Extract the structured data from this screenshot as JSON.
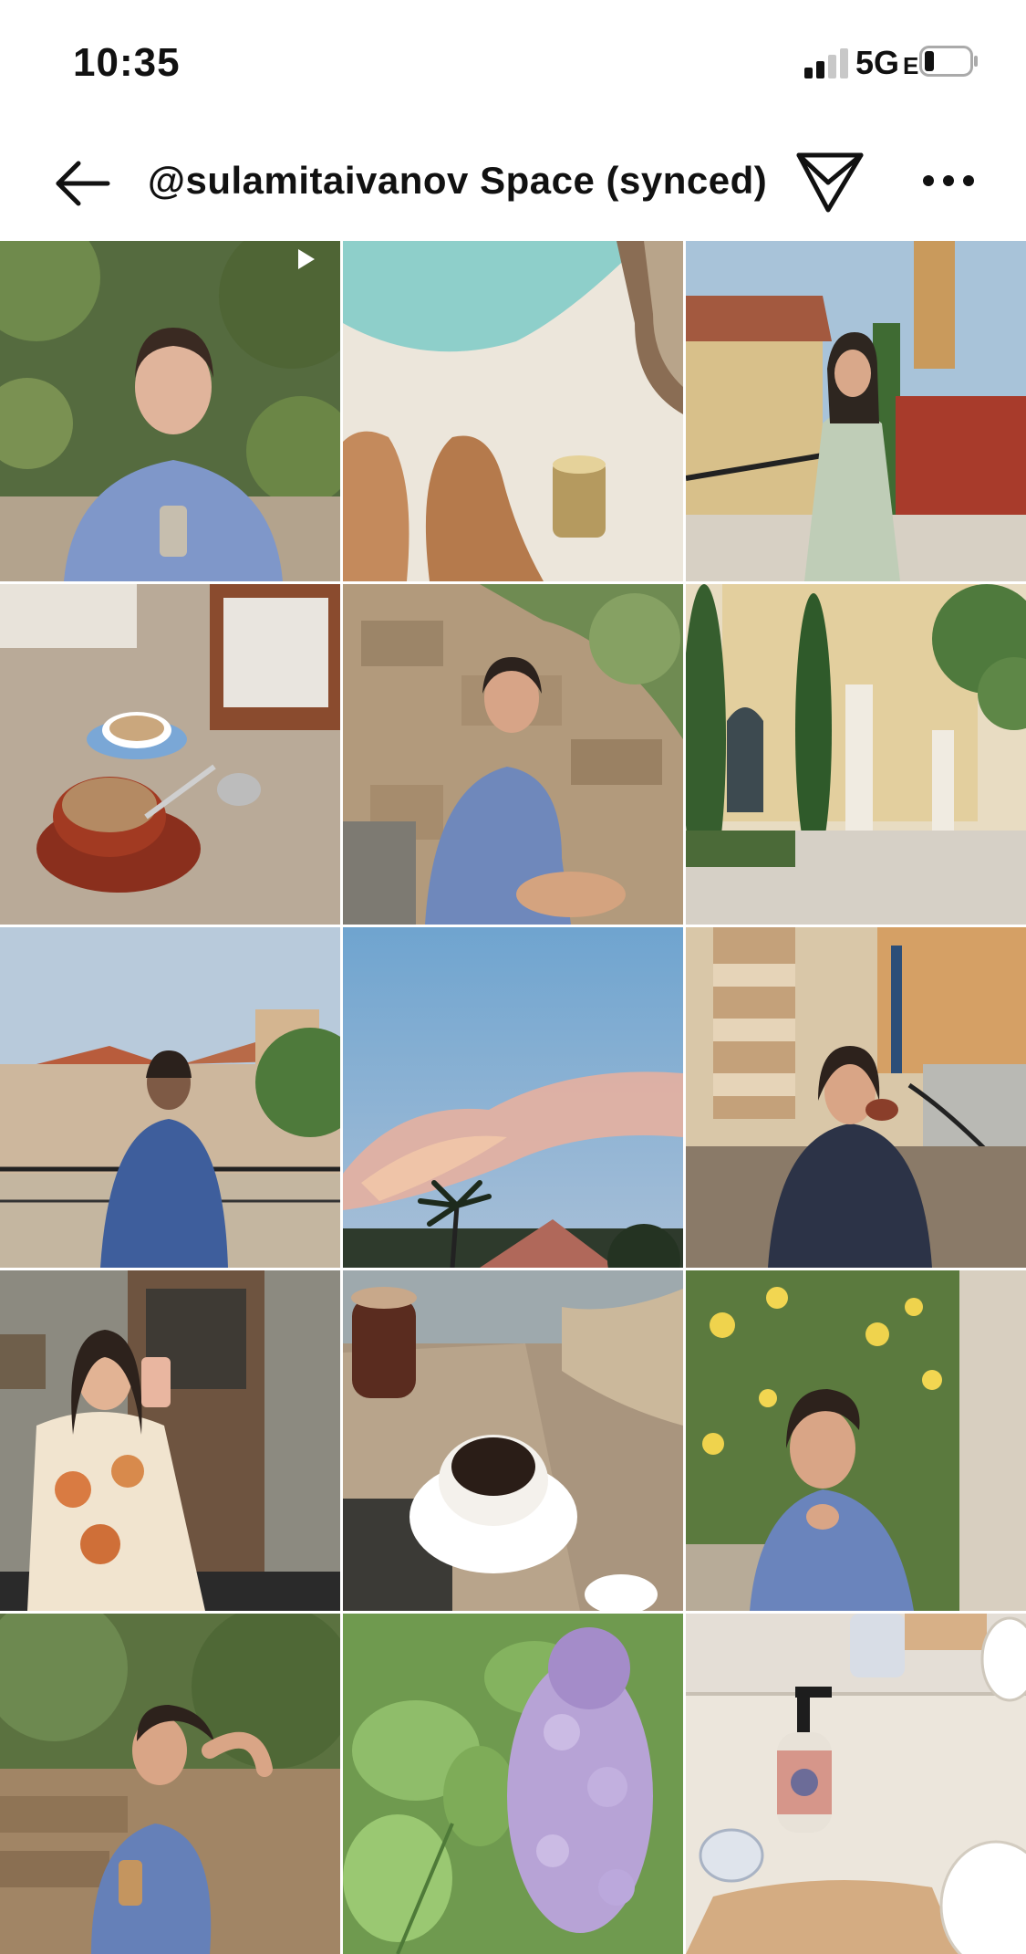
{
  "status": {
    "time": "10:35",
    "network": "5G",
    "network_suffix": "E",
    "battery_icon": "battery-low-icon",
    "signal_icon": "signal-bars-icon"
  },
  "header": {
    "title": "@sulamitaivanov Space (synced)",
    "back_icon": "arrow-left-icon",
    "send_icon": "send-icon",
    "more_icon": "more-horizontal-icon"
  },
  "grid": {
    "tiles": [
      {
        "subject": "woman with iced coffee among flowers",
        "badge": "reel-icon"
      },
      {
        "subject": "pool and legs with iced coffee"
      },
      {
        "subject": "woman on balcony with bell tower"
      },
      {
        "subject": "coffee cups on granite table"
      },
      {
        "subject": "woman sitting on stone steps"
      },
      {
        "subject": "villa courtyard with cypress trees"
      },
      {
        "subject": "woman on balcony over rooftops"
      },
      {
        "subject": "pink sunset clouds and palm tree"
      },
      {
        "subject": "woman drinking coffee at cafe"
      },
      {
        "subject": "mirror selfie in floral dress"
      },
      {
        "subject": "iced coffee and espresso on table"
      },
      {
        "subject": "woman among yellow flowers"
      },
      {
        "subject": "woman with iced drink by stone wall"
      },
      {
        "subject": "lilac flowers and leaves"
      },
      {
        "subject": "soap dispenser and towel on counter"
      }
    ]
  }
}
